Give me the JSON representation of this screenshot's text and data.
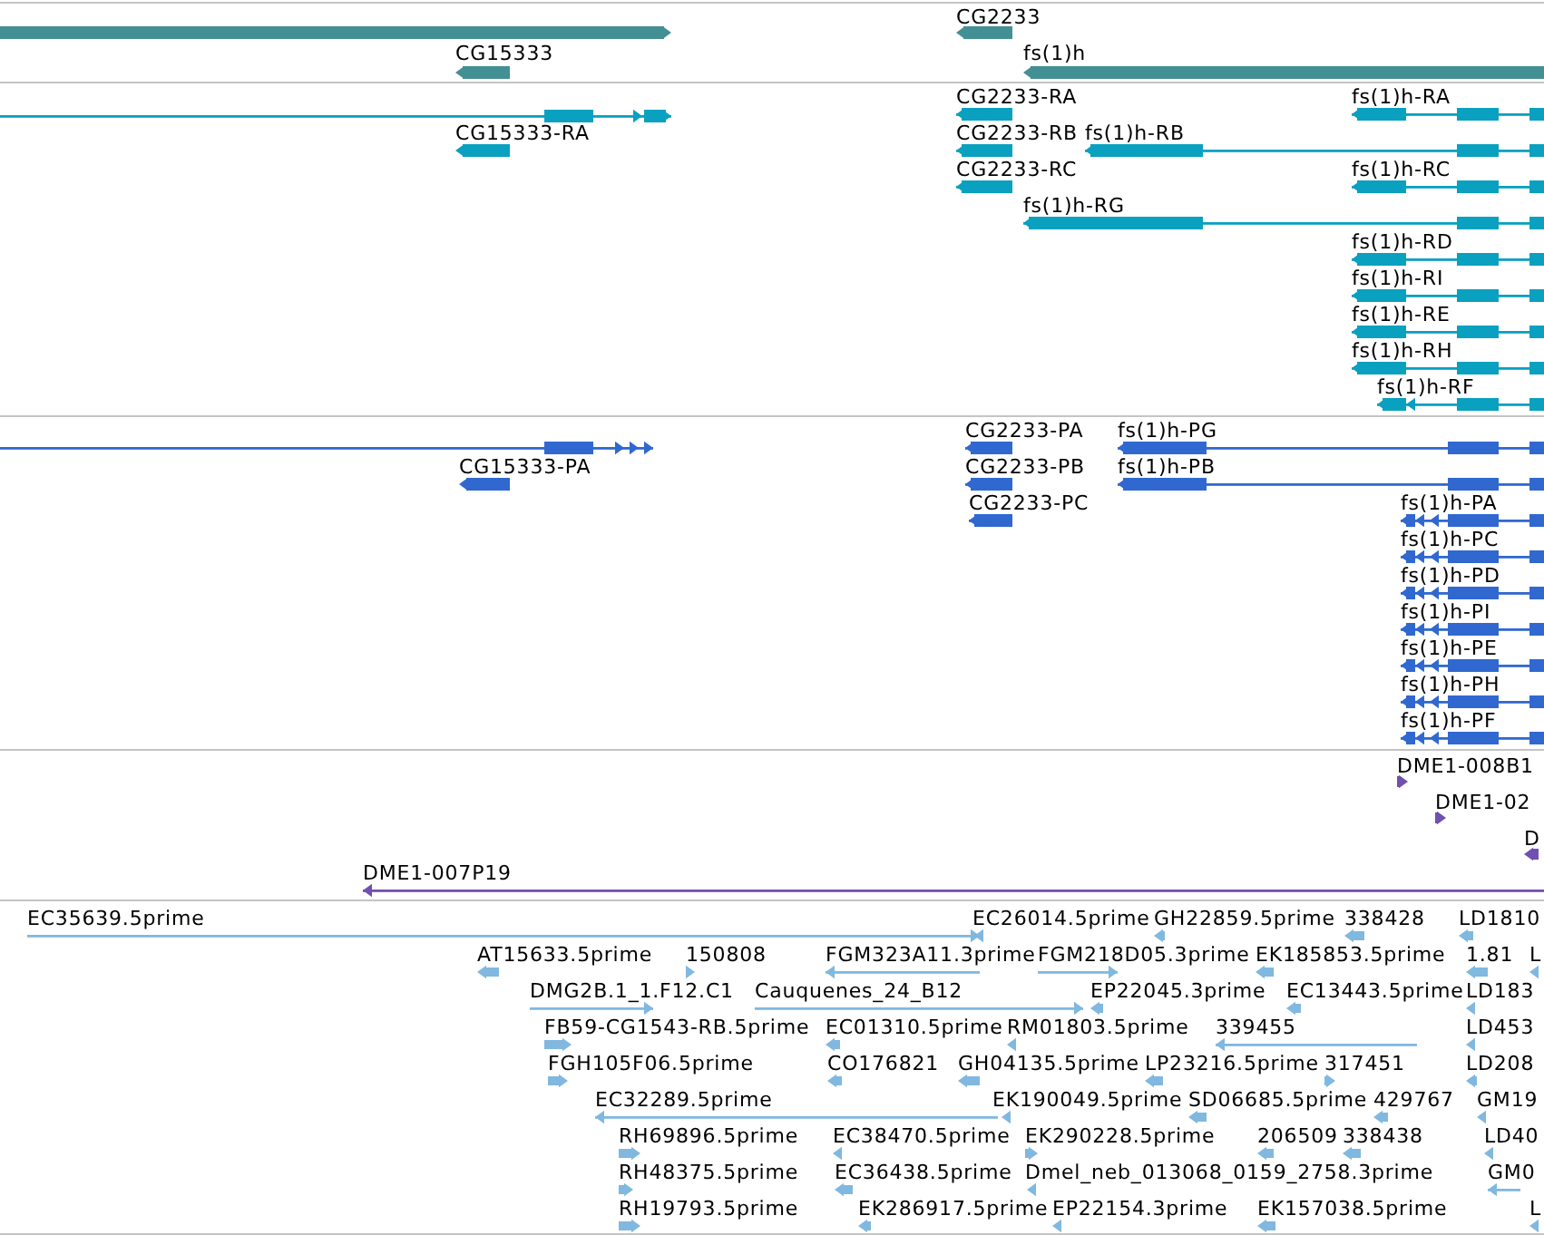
{
  "tracks": [
    {
      "color": "#428f94",
      "features": [
        {
          "forward": true
        },
        {
          "label": "CG2233",
          "forward": false
        },
        {
          "label": "CG15333",
          "forward": false
        },
        {
          "label": "fs(1)h",
          "forward": false
        }
      ]
    },
    {
      "color": "#0aa0c0",
      "features": [
        {
          "forward": true
        },
        {
          "label": "CG15333-RA",
          "forward": false
        },
        {
          "label": "CG2233-RA",
          "forward": false
        },
        {
          "label": "fs(1)h-RA",
          "forward": false
        },
        {
          "label": "CG2233-RB",
          "forward": false
        },
        {
          "label": "fs(1)h-RB",
          "forward": false
        },
        {
          "label": "CG2233-RC",
          "forward": false
        },
        {
          "label": "fs(1)h-RC",
          "forward": false
        },
        {
          "label": "fs(1)h-RG",
          "forward": false
        },
        {
          "label": "fs(1)h-RD",
          "forward": false
        },
        {
          "label": "fs(1)h-RI",
          "forward": false
        },
        {
          "label": "fs(1)h-RE",
          "forward": false
        },
        {
          "label": "fs(1)h-RH",
          "forward": false
        },
        {
          "label": "fs(1)h-RF",
          "forward": false
        }
      ]
    },
    {
      "color": "#3068d0",
      "features": [
        {
          "forward": true
        },
        {
          "label": "CG15333-PA",
          "forward": false
        },
        {
          "label": "CG2233-PA",
          "forward": false
        },
        {
          "label": "fs(1)h-PG",
          "forward": false
        },
        {
          "label": "CG2233-PB",
          "forward": false
        },
        {
          "label": "fs(1)h-PB",
          "forward": false
        },
        {
          "label": "CG2233-PC",
          "forward": false
        },
        {
          "label": "fs(1)h-PA",
          "forward": false
        },
        {
          "label": "fs(1)h-PC",
          "forward": false
        },
        {
          "label": "fs(1)h-PD",
          "forward": false
        },
        {
          "label": "fs(1)h-PI",
          "forward": false
        },
        {
          "label": "fs(1)h-PE",
          "forward": false
        },
        {
          "label": "fs(1)h-PH",
          "forward": false
        },
        {
          "label": "fs(1)h-PF",
          "forward": false
        }
      ]
    },
    {
      "color": "#7050b0",
      "features": [
        {
          "label": "DME1-008B1",
          "forward": true
        },
        {
          "label": "DME1-02",
          "forward": true
        },
        {
          "label": "D",
          "forward": false
        },
        {
          "label": "DME1-007P19",
          "forward": false
        }
      ]
    },
    {
      "color": "#80b8e0",
      "features": [
        {
          "label": "EC35639.5prime",
          "forward": true
        },
        {
          "label": "EC26014.5prime",
          "forward": false
        },
        {
          "label": "GH22859.5prime",
          "forward": false
        },
        {
          "label": "338428",
          "forward": false
        },
        {
          "label": "LD1810",
          "forward": false
        },
        {
          "label": "AT15633.5prime",
          "forward": false
        },
        {
          "label": "150808",
          "forward": true
        },
        {
          "label": "FGM323A11.3prime",
          "forward": false
        },
        {
          "label": "FGM218D05.3prime",
          "forward": true
        },
        {
          "label": "EK185853.5prime",
          "forward": false
        },
        {
          "label": "1.81",
          "forward": false
        },
        {
          "label": "L",
          "forward": false
        },
        {
          "label": "DMG2B.1_1.F12.C1",
          "forward": true
        },
        {
          "label": "Cauquenes_24_B12",
          "forward": true
        },
        {
          "label": "EP22045.3prime",
          "forward": false
        },
        {
          "label": "EC13443.5prime",
          "forward": false
        },
        {
          "label": "LD183",
          "forward": false
        },
        {
          "label": "FB59-CG1543-RB.5prime",
          "forward": true
        },
        {
          "label": "EC01310.5prime",
          "forward": false
        },
        {
          "label": "RM01803.5prime",
          "forward": false
        },
        {
          "label": "339455",
          "forward": false
        },
        {
          "label": "LD453",
          "forward": false
        },
        {
          "label": "FGH105F06.5prime",
          "forward": true
        },
        {
          "label": "CO176821",
          "forward": false
        },
        {
          "label": "GH04135.5prime",
          "forward": false
        },
        {
          "label": "LP23216.5prime",
          "forward": false
        },
        {
          "label": "317451",
          "forward": true
        },
        {
          "label": "LD208",
          "forward": false
        },
        {
          "label": "EC32289.5prime",
          "forward": false
        },
        {
          "label": "EK190049.5prime",
          "forward": false
        },
        {
          "label": "SD06685.5prime",
          "forward": false
        },
        {
          "label": "429767",
          "forward": false
        },
        {
          "label": "GM19",
          "forward": false
        },
        {
          "label": "RH69896.5prime",
          "forward": true
        },
        {
          "label": "EC38470.5prime",
          "forward": false
        },
        {
          "label": "EK290228.5prime",
          "forward": true
        },
        {
          "label": "206509",
          "forward": false
        },
        {
          "label": "338438",
          "forward": false
        },
        {
          "label": "LD40",
          "forward": false
        },
        {
          "label": "RH48375.5prime",
          "forward": true
        },
        {
          "label": "EC36438.5prime",
          "forward": false
        },
        {
          "label": "Dmel_neb_013068_0159_2758.3prime",
          "forward": false
        },
        {
          "label": "GM0",
          "forward": false
        },
        {
          "label": "RH19793.5prime",
          "forward": true
        },
        {
          "label": "EK286917.5prime",
          "forward": false
        },
        {
          "label": "EP22154.3prime",
          "forward": false
        },
        {
          "label": "EK157038.5prime",
          "forward": false
        },
        {
          "label": "L",
          "forward": false
        }
      ]
    }
  ]
}
